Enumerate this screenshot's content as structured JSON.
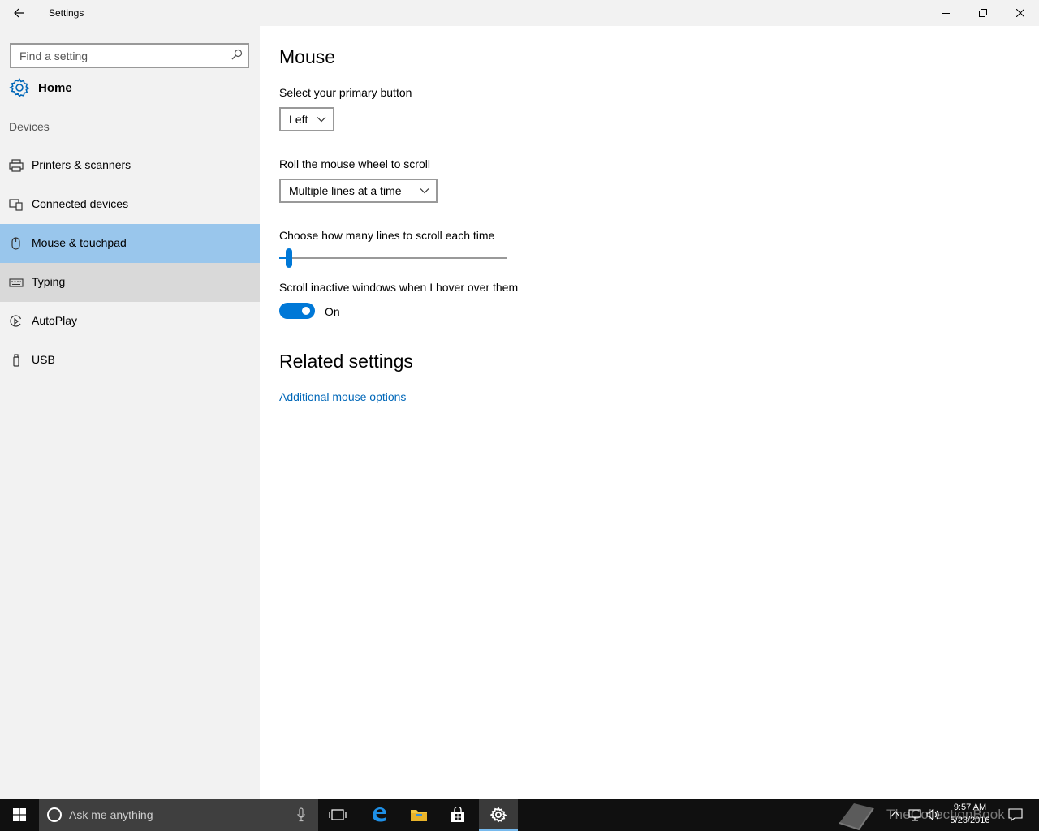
{
  "window": {
    "title": "Settings",
    "back_icon": "arrow-left-icon",
    "minimize_icon": "minimize-icon",
    "maximize_icon": "restore-icon",
    "close_icon": "close-icon"
  },
  "sidebar": {
    "search_placeholder": "Find a setting",
    "search_icon": "search-icon",
    "home_label": "Home",
    "home_icon": "gear-icon",
    "section": "Devices",
    "items": [
      {
        "label": "Printers & scanners",
        "icon": "printer-icon",
        "state": "normal"
      },
      {
        "label": "Connected devices",
        "icon": "connected-devices-icon",
        "state": "normal"
      },
      {
        "label": "Mouse & touchpad",
        "icon": "mouse-icon",
        "state": "selected"
      },
      {
        "label": "Typing",
        "icon": "keyboard-icon",
        "state": "hover"
      },
      {
        "label": "AutoPlay",
        "icon": "autoplay-icon",
        "state": "normal"
      },
      {
        "label": "USB",
        "icon": "usb-icon",
        "state": "normal"
      }
    ]
  },
  "main": {
    "title": "Mouse",
    "primary_button": {
      "label": "Select your primary button",
      "value": "Left"
    },
    "wheel_scroll": {
      "label": "Roll the mouse wheel to scroll",
      "value": "Multiple lines at a time"
    },
    "lines_slider": {
      "label": "Choose how many lines to scroll each time",
      "fraction": 0.03
    },
    "inactive_scroll": {
      "label": "Scroll inactive windows when I hover over them",
      "state": "On"
    },
    "related": {
      "title": "Related settings",
      "link": "Additional mouse options"
    }
  },
  "taskbar": {
    "search_placeholder": "Ask me anything",
    "apps": [
      "task-view-icon",
      "edge-icon",
      "file-explorer-icon",
      "store-icon",
      "settings-icon"
    ],
    "active_app": "settings-icon",
    "time": "9:57 AM",
    "date": "5/23/2016",
    "watermark": "TheCollectionBook",
    "accent": "#0078d7"
  }
}
